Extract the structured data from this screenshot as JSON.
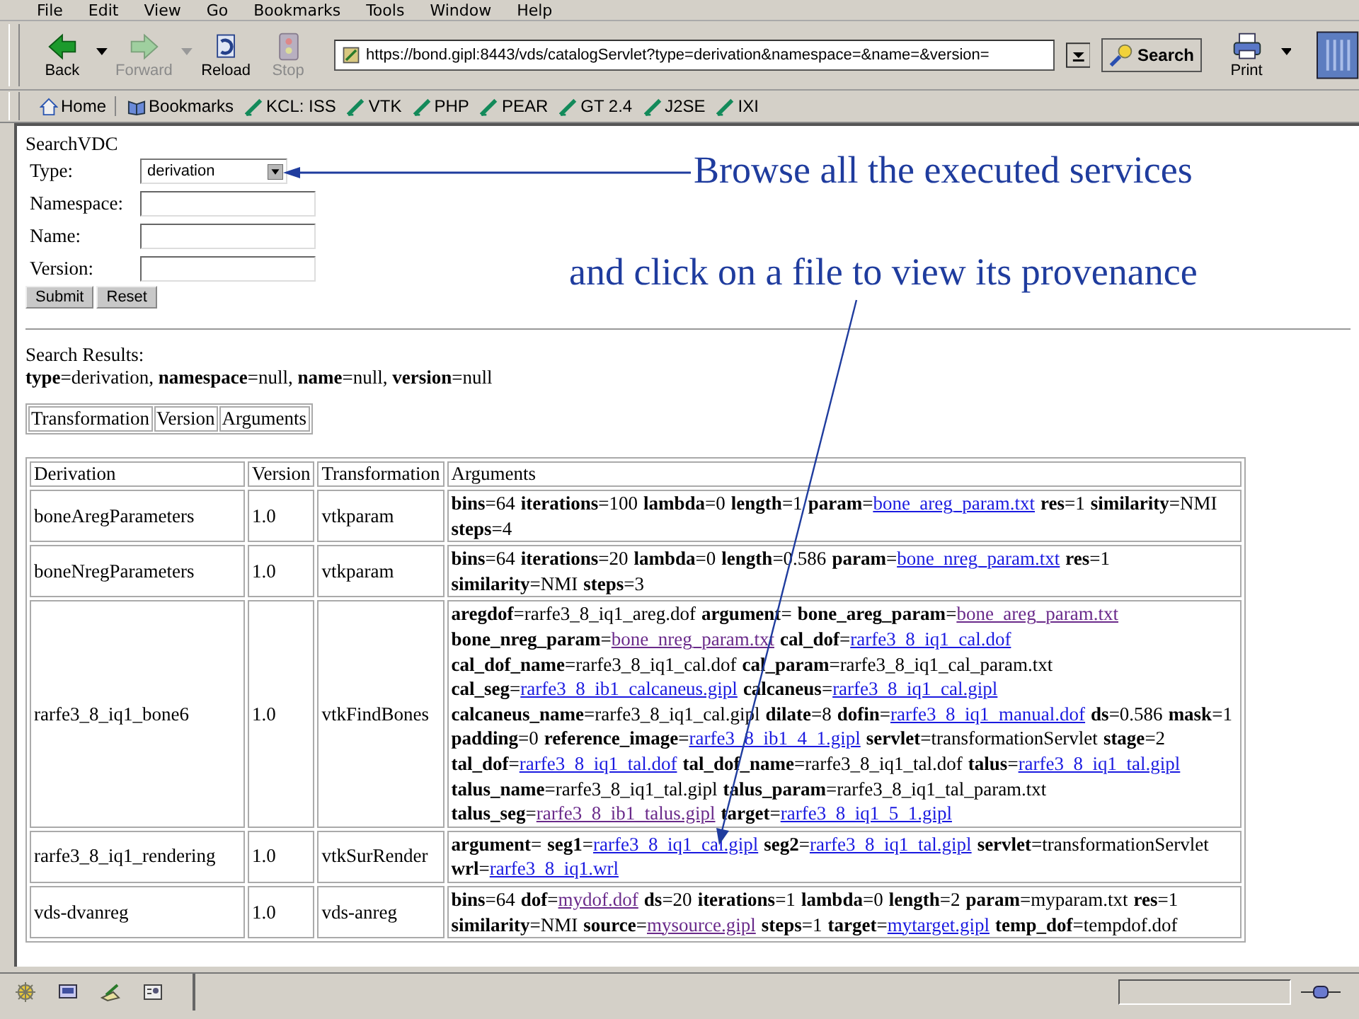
{
  "menu": [
    "File",
    "Edit",
    "View",
    "Go",
    "Bookmarks",
    "Tools",
    "Window",
    "Help"
  ],
  "toolbar": {
    "buttons": [
      {
        "label": "Back",
        "kind": "back",
        "disabled": false,
        "dropdown": true
      },
      {
        "label": "Forward",
        "kind": "forward",
        "disabled": true,
        "dropdown": true
      },
      {
        "label": "Reload",
        "kind": "reload",
        "disabled": false,
        "dropdown": false
      },
      {
        "label": "Stop",
        "kind": "stop",
        "disabled": true,
        "dropdown": false
      }
    ],
    "address": "https://bond.gipl:8443/vds/catalogServlet?type=derivation&namespace=&name=&version=",
    "search_button": "Search",
    "print_button": {
      "label": "Print",
      "dropdown": true
    }
  },
  "bookmarks_bar": [
    {
      "label": "Home",
      "kind": "home"
    },
    {
      "label": "Bookmarks",
      "kind": "bookmarks"
    },
    {
      "label": "KCL: ISS",
      "kind": "link"
    },
    {
      "label": "VTK",
      "kind": "link"
    },
    {
      "label": "PHP",
      "kind": "link"
    },
    {
      "label": "PEAR",
      "kind": "link"
    },
    {
      "label": "GT 2.4",
      "kind": "link"
    },
    {
      "label": "J2SE",
      "kind": "link"
    },
    {
      "label": "IXI",
      "kind": "link"
    }
  ],
  "page": {
    "heading": "SearchVDC",
    "fields": [
      {
        "label": "Type:",
        "kind": "select",
        "value": "derivation"
      },
      {
        "label": "Namespace:",
        "kind": "text"
      },
      {
        "label": "Name:",
        "kind": "text"
      },
      {
        "label": "Version:",
        "kind": "text"
      }
    ],
    "buttons": [
      "Submit",
      "Reset"
    ],
    "results_title": "Search Results:",
    "results_query": "**type**=derivation, **namespace**=null, **name**=null, **version**=null",
    "view_table": [
      "Transformation",
      "Version",
      "Arguments"
    ],
    "table": {
      "columns": [
        "Derivation",
        "Version",
        "Transformation",
        "Arguments"
      ],
      "rows": [
        {
          "derivation": "boneAregParameters",
          "version": "1.0",
          "transformation": "vtkparam",
          "arguments": [
            [
              {
                "k": "bins",
                "v": "=64"
              },
              {
                "k": "iterations",
                "v": "=100"
              },
              {
                "k": "lambda",
                "v": "=0"
              },
              {
                "k": "length",
                "v": "=1"
              },
              {
                "k": "param",
                "v": "=",
                "link": "bone_areg_param.txt",
                "visited": false
              },
              {
                "k": "res",
                "v": "=1"
              },
              {
                "k": "similarity",
                "v": "=NMI"
              }
            ],
            [
              {
                "k": "steps",
                "v": "=4"
              }
            ]
          ]
        },
        {
          "derivation": "boneNregParameters",
          "version": "1.0",
          "transformation": "vtkparam",
          "arguments": [
            [
              {
                "k": "bins",
                "v": "=64"
              },
              {
                "k": "iterations",
                "v": "=20"
              },
              {
                "k": "lambda",
                "v": "=0"
              },
              {
                "k": "length",
                "v": "=0.586"
              },
              {
                "k": "param",
                "v": "=",
                "link": "bone_nreg_param.txt",
                "visited": false
              },
              {
                "k": "res",
                "v": "=1"
              }
            ],
            [
              {
                "k": "similarity",
                "v": "=NMI"
              },
              {
                "k": "steps",
                "v": "=3"
              }
            ]
          ]
        },
        {
          "derivation": "rarfe3_8_iq1_bone6",
          "version": "1.0",
          "transformation": "vtkFindBones",
          "arguments": [
            [
              {
                "k": "aregdof",
                "v": "=rarfe3_8_iq1_areg.dof"
              },
              {
                "k": "argument",
                "v": "="
              },
              {
                "k": "bone_areg_param",
                "v": "=",
                "link": "bone_areg_param.txt",
                "visited": true
              }
            ],
            [
              {
                "k": "bone_nreg_param",
                "v": "=",
                "link": "bone_nreg_param.txt",
                "visited": true
              },
              {
                "k": "cal_dof",
                "v": "=",
                "link": "rarfe3_8_iq1_cal.dof",
                "visited": false
              }
            ],
            [
              {
                "k": "cal_dof_name",
                "v": "=rarfe3_8_iq1_cal.dof"
              },
              {
                "k": "cal_param",
                "v": "=rarfe3_8_iq1_cal_param.txt"
              }
            ],
            [
              {
                "k": "cal_seg",
                "v": "=",
                "link": "rarfe3_8_ib1_calcaneus.gipl",
                "visited": false
              },
              {
                "k": "calcaneus",
                "v": "=",
                "link": "rarfe3_8_iq1_cal.gipl",
                "visited": false
              }
            ],
            [
              {
                "k": "calcaneus_name",
                "v": "=rarfe3_8_iq1_cal.gipl"
              },
              {
                "k": "dilate",
                "v": "=8"
              },
              {
                "k": "dofin",
                "v": "=",
                "link": "rarfe3_8_iq1_manual.dof",
                "visited": false
              },
              {
                "k": "ds",
                "v": "=0.586"
              },
              {
                "k": "mask",
                "v": "=1"
              }
            ],
            [
              {
                "k": "padding",
                "v": "=0"
              },
              {
                "k": "reference_image",
                "v": "=",
                "link": "rarfe3_8_ib1_4_1.gipl",
                "visited": false
              },
              {
                "k": "servlet",
                "v": "=transformationServlet"
              },
              {
                "k": "stage",
                "v": "=2"
              }
            ],
            [
              {
                "k": "tal_dof",
                "v": "=",
                "link": "rarfe3_8_iq1_tal.dof",
                "visited": false
              },
              {
                "k": "tal_dof_name",
                "v": "=rarfe3_8_iq1_tal.dof"
              },
              {
                "k": "talus",
                "v": "=",
                "link": "rarfe3_8_iq1_tal.gipl",
                "visited": false
              }
            ],
            [
              {
                "k": "talus_name",
                "v": "=rarfe3_8_iq1_tal.gipl"
              },
              {
                "k": "talus_param",
                "v": "=rarfe3_8_iq1_tal_param.txt"
              }
            ],
            [
              {
                "k": "talus_seg",
                "v": "=",
                "link": "rarfe3_8_ib1_talus.gipl",
                "visited": true
              },
              {
                "k": "target",
                "v": "=",
                "link": "rarfe3_8_iq1_5_1.gipl",
                "visited": false
              }
            ]
          ]
        },
        {
          "derivation": "rarfe3_8_iq1_rendering",
          "version": "1.0",
          "transformation": "vtkSurRender",
          "arguments": [
            [
              {
                "k": "argument",
                "v": "="
              },
              {
                "k": "seg1",
                "v": "=",
                "link": "rarfe3_8_iq1_cal.gipl",
                "visited": false
              },
              {
                "k": "seg2",
                "v": "=",
                "link": "rarfe3_8_iq1_tal.gipl",
                "visited": false
              },
              {
                "k": "servlet",
                "v": "=transformationServlet"
              }
            ],
            [
              {
                "k": "wrl",
                "v": "=",
                "link": "rarfe3_8_iq1.wrl",
                "visited": false
              }
            ]
          ]
        },
        {
          "derivation": "vds-dvanreg",
          "version": "1.0",
          "transformation": "vds-anreg",
          "arguments": [
            [
              {
                "k": "bins",
                "v": "=64"
              },
              {
                "k": "dof",
                "v": "=",
                "link": "mydof.dof",
                "visited": true
              },
              {
                "k": "ds",
                "v": "=20"
              },
              {
                "k": "iterations",
                "v": "=1"
              },
              {
                "k": "lambda",
                "v": "=0"
              },
              {
                "k": "length",
                "v": "=2"
              },
              {
                "k": "param",
                "v": "=myparam.txt"
              },
              {
                "k": "res",
                "v": "=1"
              }
            ],
            [
              {
                "k": "similarity",
                "v": "=NMI"
              },
              {
                "k": "source",
                "v": "=",
                "link": "mysource.gipl",
                "visited": true
              },
              {
                "k": "steps",
                "v": "=1"
              },
              {
                "k": "target",
                "v": "=",
                "link": "mytarget.gipl",
                "visited": false
              },
              {
                "k": "temp_dof",
                "v": "=tempdof.dof"
              }
            ]
          ]
        }
      ]
    }
  },
  "annotations": [
    {
      "text": "Browse all the executed services"
    },
    {
      "text": "and click on a file to view its provenance"
    }
  ]
}
